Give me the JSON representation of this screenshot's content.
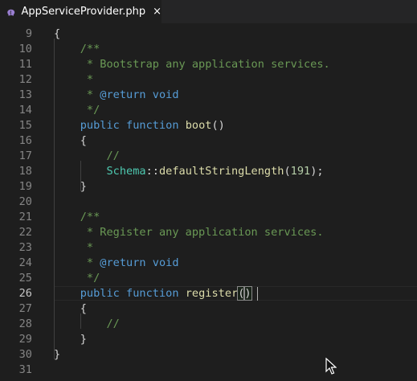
{
  "tab": {
    "filename": "AppServiceProvider.php",
    "close_glyph": "×",
    "icon": "php-elephant-icon",
    "icon_color": "#9a7fd1"
  },
  "editor": {
    "active_line": "26",
    "lines": [
      {
        "num": "9",
        "tokens": [
          {
            "t": "{",
            "c": "punc"
          }
        ]
      },
      {
        "num": "10",
        "tokens": [
          {
            "t": "    /**",
            "c": "comment"
          }
        ]
      },
      {
        "num": "11",
        "tokens": [
          {
            "t": "     * Bootstrap any application services.",
            "c": "comment"
          }
        ]
      },
      {
        "num": "12",
        "tokens": [
          {
            "t": "     *",
            "c": "comment"
          }
        ]
      },
      {
        "num": "13",
        "tokens": [
          {
            "t": "     * ",
            "c": "comment"
          },
          {
            "t": "@return",
            "c": "keyword"
          },
          {
            "t": " ",
            "c": "comment"
          },
          {
            "t": "void",
            "c": "keyword"
          }
        ]
      },
      {
        "num": "14",
        "tokens": [
          {
            "t": "     */",
            "c": "comment"
          }
        ]
      },
      {
        "num": "15",
        "tokens": [
          {
            "t": "    ",
            "c": "punc"
          },
          {
            "t": "public",
            "c": "keyword"
          },
          {
            "t": " ",
            "c": "punc"
          },
          {
            "t": "function",
            "c": "keyword"
          },
          {
            "t": " ",
            "c": "punc"
          },
          {
            "t": "boot",
            "c": "func"
          },
          {
            "t": "()",
            "c": "punc"
          }
        ]
      },
      {
        "num": "16",
        "tokens": [
          {
            "t": "    {",
            "c": "punc"
          }
        ]
      },
      {
        "num": "17",
        "tokens": [
          {
            "t": "        //",
            "c": "comment"
          }
        ]
      },
      {
        "num": "18",
        "tokens": [
          {
            "t": "        ",
            "c": "punc"
          },
          {
            "t": "Schema",
            "c": "class"
          },
          {
            "t": "::",
            "c": "punc"
          },
          {
            "t": "defaultStringLength",
            "c": "func"
          },
          {
            "t": "(",
            "c": "punc"
          },
          {
            "t": "191",
            "c": "num"
          },
          {
            "t": ");",
            "c": "punc"
          }
        ]
      },
      {
        "num": "19",
        "tokens": [
          {
            "t": "    }",
            "c": "punc"
          }
        ]
      },
      {
        "num": "20",
        "tokens": []
      },
      {
        "num": "21",
        "tokens": [
          {
            "t": "    /**",
            "c": "comment"
          }
        ]
      },
      {
        "num": "22",
        "tokens": [
          {
            "t": "     * Register any application services.",
            "c": "comment"
          }
        ]
      },
      {
        "num": "23",
        "tokens": [
          {
            "t": "     *",
            "c": "comment"
          }
        ]
      },
      {
        "num": "24",
        "tokens": [
          {
            "t": "     * ",
            "c": "comment"
          },
          {
            "t": "@return",
            "c": "keyword"
          },
          {
            "t": " ",
            "c": "comment"
          },
          {
            "t": "void",
            "c": "keyword"
          }
        ]
      },
      {
        "num": "25",
        "tokens": [
          {
            "t": "     */",
            "c": "comment"
          }
        ]
      },
      {
        "num": "26",
        "tokens": [
          {
            "t": "    ",
            "c": "punc"
          },
          {
            "t": "public",
            "c": "keyword"
          },
          {
            "t": " ",
            "c": "punc"
          },
          {
            "t": "function",
            "c": "keyword"
          },
          {
            "t": " ",
            "c": "punc"
          },
          {
            "t": "register",
            "c": "func"
          },
          {
            "t": "(",
            "c": "bracket"
          },
          {
            "t": ")",
            "c": "bracket"
          }
        ]
      },
      {
        "num": "27",
        "tokens": [
          {
            "t": "    {",
            "c": "punc"
          }
        ]
      },
      {
        "num": "28",
        "tokens": [
          {
            "t": "        //",
            "c": "comment"
          }
        ]
      },
      {
        "num": "29",
        "tokens": [
          {
            "t": "    }",
            "c": "punc"
          }
        ]
      },
      {
        "num": "30",
        "tokens": [
          {
            "t": "}",
            "c": "punc"
          }
        ]
      },
      {
        "num": "31",
        "tokens": []
      }
    ]
  }
}
